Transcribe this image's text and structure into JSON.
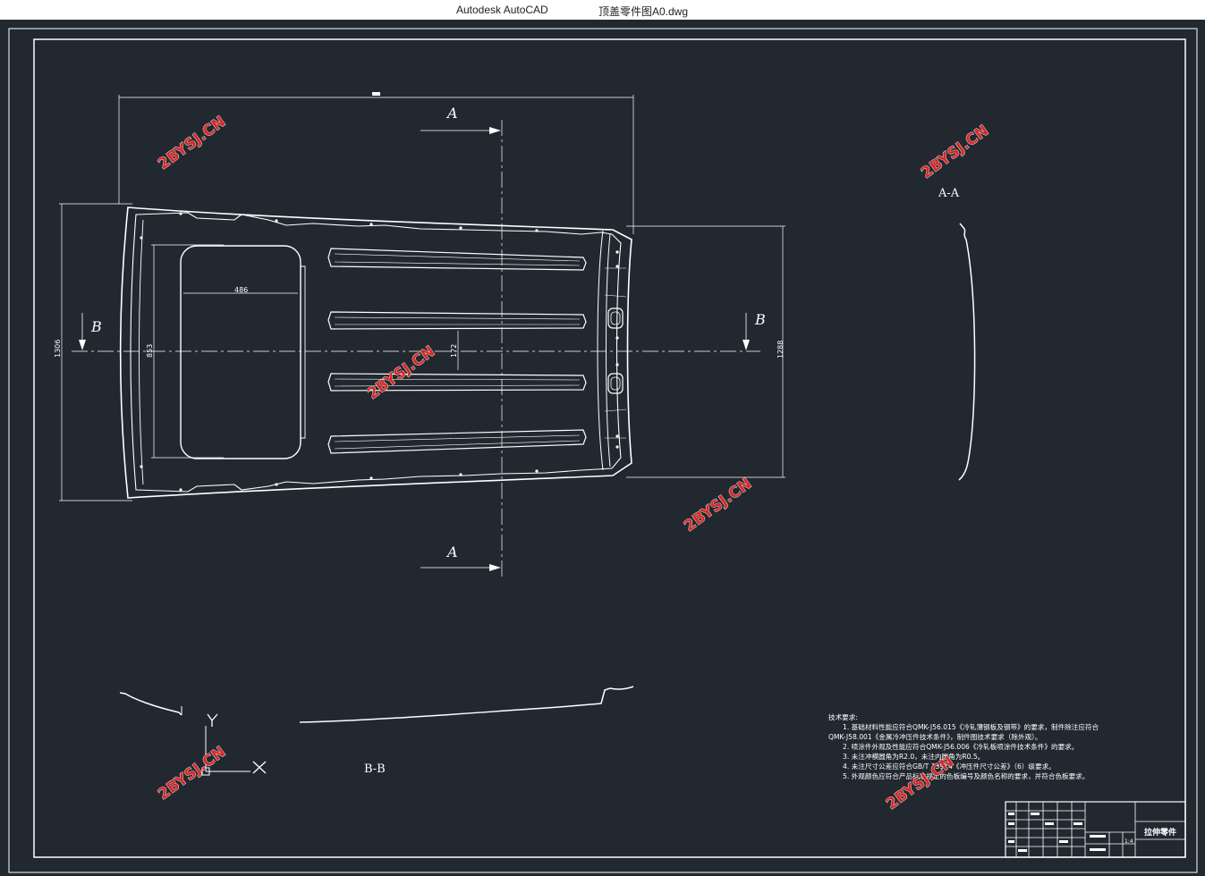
{
  "window": {
    "app_name": "Autodesk AutoCAD",
    "document_name": "顶盖零件图A0.dwg"
  },
  "drawing": {
    "section_a_label": "A",
    "section_b_label": "B",
    "view_aa_label": "A-A",
    "view_bb_label": "B-B",
    "dim_overall_width": "1306",
    "dim_sunroof_length": "853",
    "dim_sunroof_width": "486",
    "dim_center_offset": "172",
    "dim_rear_width": "1288",
    "ucs_x": "X",
    "ucs_y": "Y"
  },
  "watermark": {
    "text": "2BYSJ.CN",
    "color": "#d42a2a"
  },
  "notes": {
    "title": "技术要求:",
    "lines": [
      "1. 基础材料性能应符合QMK-J56.015《冷轧薄钢板及钢带》的要求，制件除注应符合",
      "QMK-J58.001《金属冷冲压件技术条件》，制件图技术要求（除外观）。",
      "2. 喷涂件外观及性能应符合QMK-J56.006《冷轧板喷涂件技术条件》的要求。",
      "3. 未注冲模圆角为R2.0，未注内圆角为R0.5。",
      "4. 未注尺寸公差应符合GB/T 13914《冲压件尺寸公差》（6）级要求。",
      "5. 外观颜色应符合产品标准规定的色板编号及颜色名称的要求，并符合色板要求。"
    ]
  },
  "title_block": {
    "part_name": "拉伸零件",
    "scale": "1:4"
  },
  "colors": {
    "background": "#212830",
    "lines": "#ffffff"
  }
}
